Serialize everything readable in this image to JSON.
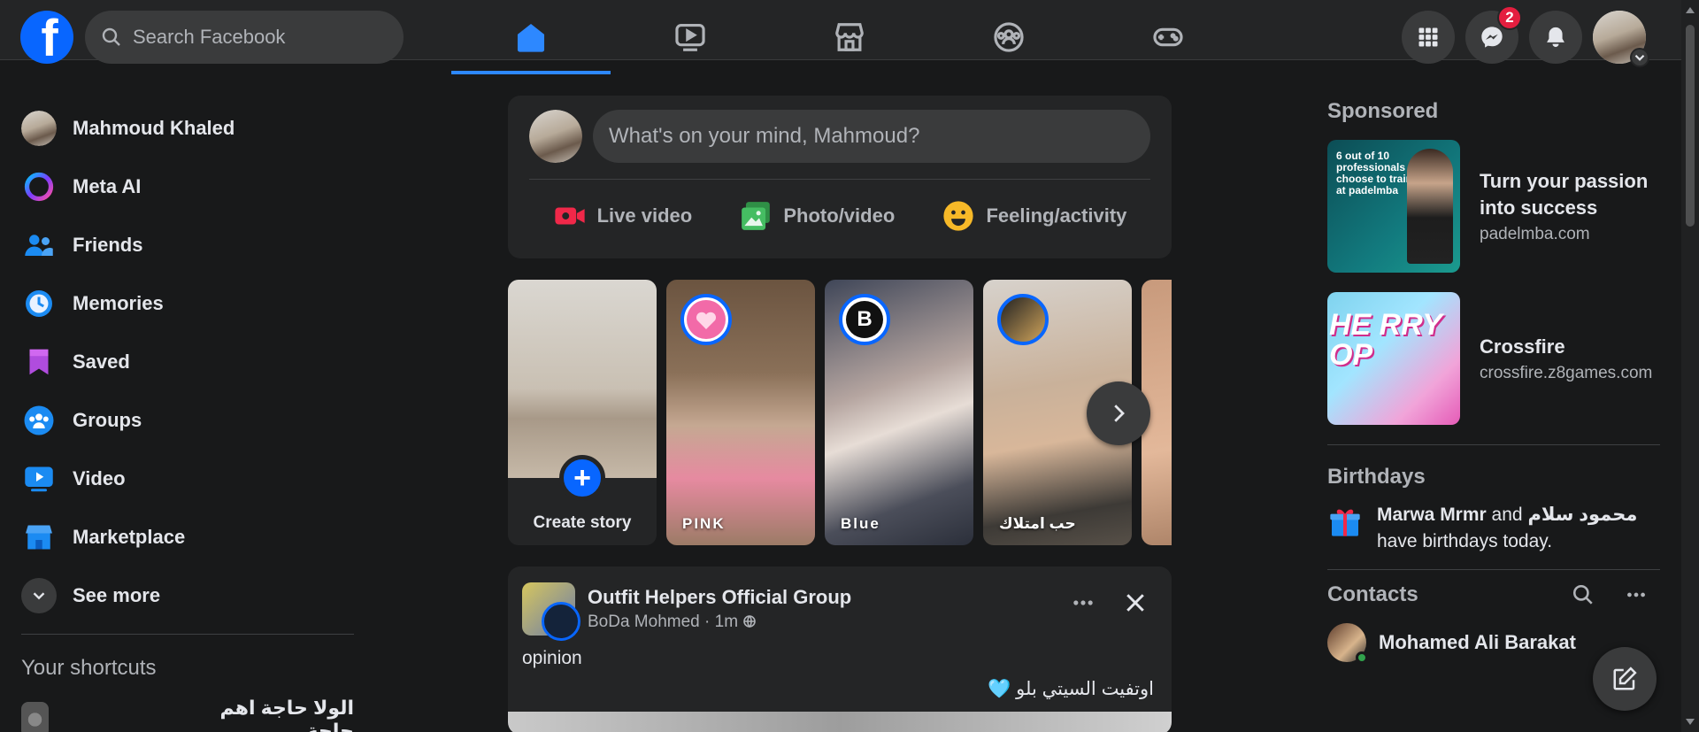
{
  "header": {
    "search_placeholder": "Search Facebook",
    "tabs": [
      {
        "name": "home",
        "active": true
      },
      {
        "name": "video",
        "active": false
      },
      {
        "name": "marketplace",
        "active": false
      },
      {
        "name": "groups",
        "active": false
      },
      {
        "name": "gaming",
        "active": false
      }
    ],
    "messenger_badge": "2",
    "accent_color": "#2d88ff"
  },
  "sidebar": {
    "profile_name": "Mahmoud Khaled",
    "items": [
      {
        "label": "Meta AI",
        "icon": "meta-ai-icon"
      },
      {
        "label": "Friends",
        "icon": "friends-icon"
      },
      {
        "label": "Memories",
        "icon": "memories-icon"
      },
      {
        "label": "Saved",
        "icon": "saved-icon"
      },
      {
        "label": "Groups",
        "icon": "groups-icon"
      },
      {
        "label": "Video",
        "icon": "video-icon"
      },
      {
        "label": "Marketplace",
        "icon": "marketplace-icon"
      }
    ],
    "see_more": "See more",
    "shortcuts_title": "Your shortcuts",
    "shortcuts": [
      {
        "label": "الولا حاجة اهم حاجة"
      }
    ]
  },
  "composer": {
    "placeholder": "What's on your mind, Mahmoud?",
    "actions": [
      {
        "label": "Live video",
        "icon": "live-video-icon",
        "color": "#f02849"
      },
      {
        "label": "Photo/video",
        "icon": "photo-video-icon",
        "color": "#45bd62"
      },
      {
        "label": "Feeling/activity",
        "icon": "feeling-icon",
        "color": "#f7b928"
      }
    ]
  },
  "stories": {
    "create_label": "Create story",
    "items": [
      {
        "name": "PINK",
        "avatar": "heart"
      },
      {
        "name": "Blue",
        "avatar": "B"
      },
      {
        "name": "حب امتلاك",
        "avatar": "photo"
      }
    ]
  },
  "post": {
    "group": "Outfit Helpers Official Group",
    "author": "BoDa Mohmed",
    "time": "1m",
    "text": "opinion",
    "text_rtl": "اوتفيت السيتي بلو 🩵"
  },
  "right": {
    "sponsored_title": "Sponsored",
    "ads": [
      {
        "title": "Turn your passion into success",
        "url": "padelmba.com",
        "image_text": "6 out of 10 professionals choose to train at padelmba"
      },
      {
        "title": "Crossfire",
        "url": "crossfire.z8games.com",
        "image_text": "HE RRY OP"
      }
    ],
    "birthdays_title": "Birthdays",
    "birthday_name1": "Marwa Mrmr",
    "birthday_and": "and",
    "birthday_name2": "محمود سلام",
    "birthday_suffix": "have birthdays today.",
    "contacts_title": "Contacts",
    "contacts": [
      {
        "name": "Mohamed Ali Barakat",
        "online": true
      }
    ]
  }
}
